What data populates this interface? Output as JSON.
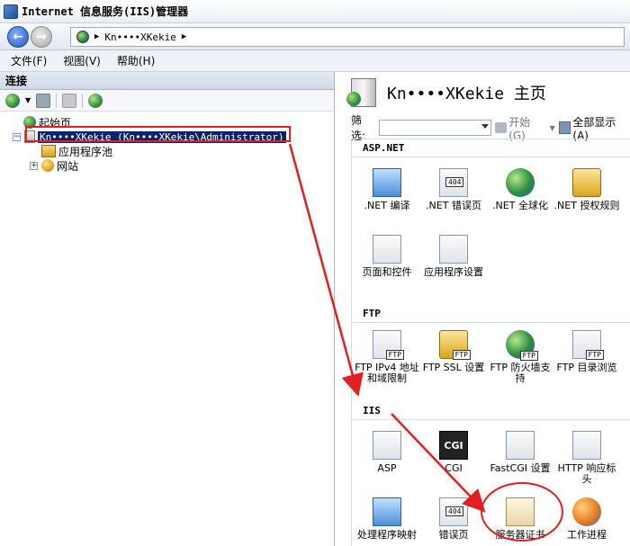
{
  "window": {
    "title": "Internet 信息服务(IIS)管理器"
  },
  "address": {
    "segment": "Kn••••XKekie"
  },
  "menu": {
    "items": [
      "文件(F)",
      "视图(V)",
      "帮助(H)"
    ]
  },
  "left": {
    "header": "连接",
    "tree": {
      "start_page": "起始页",
      "server": "Kn••••XKekie (Kn••••XKekie\\Administrator)",
      "app_pools": "应用程序池",
      "sites": "网站"
    }
  },
  "right": {
    "home_title": "Kn••••XKekie 主页",
    "filter_label": "筛选:",
    "go_label": "开始(G)",
    "show_all": "全部显示(A)",
    "groups": {
      "aspnet": {
        "title": "ASP.NET",
        "items": [
          ".NET 编译",
          ".NET 错误页",
          ".NET 全球化",
          ".NET 授权规则",
          "页面和控件",
          "应用程序设置"
        ]
      },
      "ftp": {
        "title": "FTP",
        "items": [
          "FTP IPv4 地址和域限制",
          "FTP SSL 设置",
          "FTP 防火墙支持",
          "FTP 目录浏览"
        ]
      },
      "iis": {
        "title": "IIS",
        "items": [
          "ASP",
          "CGI",
          "FastCGI 设置",
          "HTTP 响应标头",
          "处理程序映射",
          "错误页",
          "服务器证书",
          "工作进程"
        ]
      }
    }
  },
  "colors": {
    "selection": "#0a246a",
    "annotation": "#e02020"
  }
}
